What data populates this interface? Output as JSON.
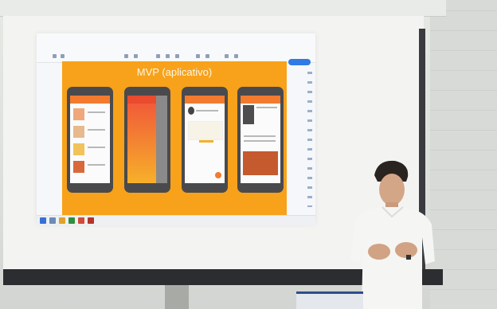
{
  "slide": {
    "title": "MVP (aplicativo)"
  },
  "colors": {
    "slide_background": "#f7a21a",
    "app_header": "#f27b2f",
    "phone_body": "#4a4a4d",
    "share_button": "#2f7ae5"
  }
}
